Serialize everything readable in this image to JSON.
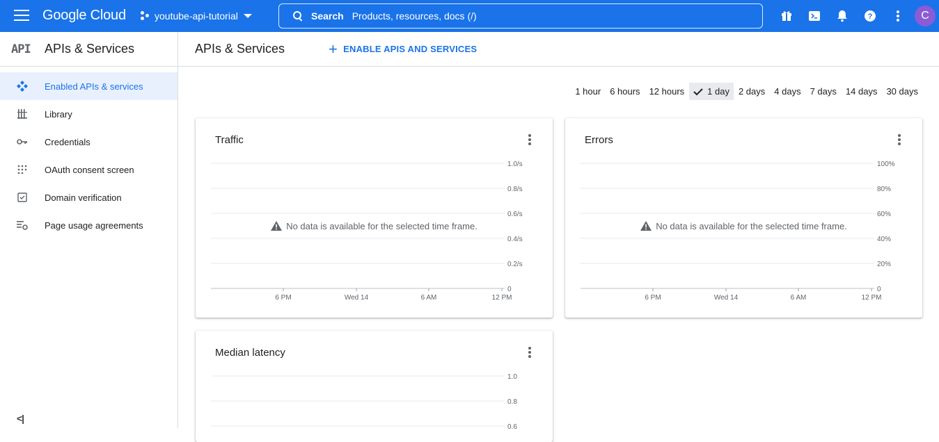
{
  "topbar": {
    "logo": "Google Cloud",
    "project": "youtube-api-tutorial",
    "search_label": "Search",
    "search_placeholder": "Products, resources, docs (/)",
    "avatar_letter": "C"
  },
  "sidebar": {
    "logo_text": "API",
    "title": "APIs & Services",
    "items": [
      {
        "label": "Enabled APIs & services",
        "icon": "enabled-apis-icon",
        "active": true
      },
      {
        "label": "Library",
        "icon": "library-icon",
        "active": false
      },
      {
        "label": "Credentials",
        "icon": "key-icon",
        "active": false
      },
      {
        "label": "OAuth consent screen",
        "icon": "oauth-icon",
        "active": false
      },
      {
        "label": "Domain verification",
        "icon": "checkbox-icon",
        "active": false
      },
      {
        "label": "Page usage agreements",
        "icon": "settings-list-icon",
        "active": false
      }
    ],
    "collapse": "<|"
  },
  "main": {
    "title": "APIs & Services",
    "enable_button": "ENABLE APIS AND SERVICES",
    "time_ranges": [
      "1 hour",
      "6 hours",
      "12 hours",
      "1 day",
      "2 days",
      "4 days",
      "7 days",
      "14 days",
      "30 days"
    ],
    "selected_range": "1 day"
  },
  "colors": {
    "brand_blue": "#1a73e8",
    "active_bg": "#e8f0fe",
    "avatar": "#8a5cd6"
  },
  "chart_data": [
    {
      "type": "line",
      "title": "Traffic",
      "x_ticks": [
        "6 PM",
        "Wed 14",
        "6 AM",
        "12 PM"
      ],
      "y_ticks": [
        "1.0/s",
        "0.8/s",
        "0.6/s",
        "0.4/s",
        "0.2/s",
        "0"
      ],
      "ylim": [
        0,
        1.0
      ],
      "series": [],
      "message": "No data is available for the selected time frame."
    },
    {
      "type": "line",
      "title": "Errors",
      "x_ticks": [
        "6 PM",
        "Wed 14",
        "6 AM",
        "12 PM"
      ],
      "y_ticks": [
        "100%",
        "80%",
        "60%",
        "40%",
        "20%",
        "0"
      ],
      "ylim": [
        0,
        100
      ],
      "series": [],
      "message": "No data is available for the selected time frame."
    },
    {
      "type": "line",
      "title": "Median latency",
      "y_ticks": [
        "1.0",
        "0.8",
        "0.6"
      ],
      "series": []
    }
  ]
}
